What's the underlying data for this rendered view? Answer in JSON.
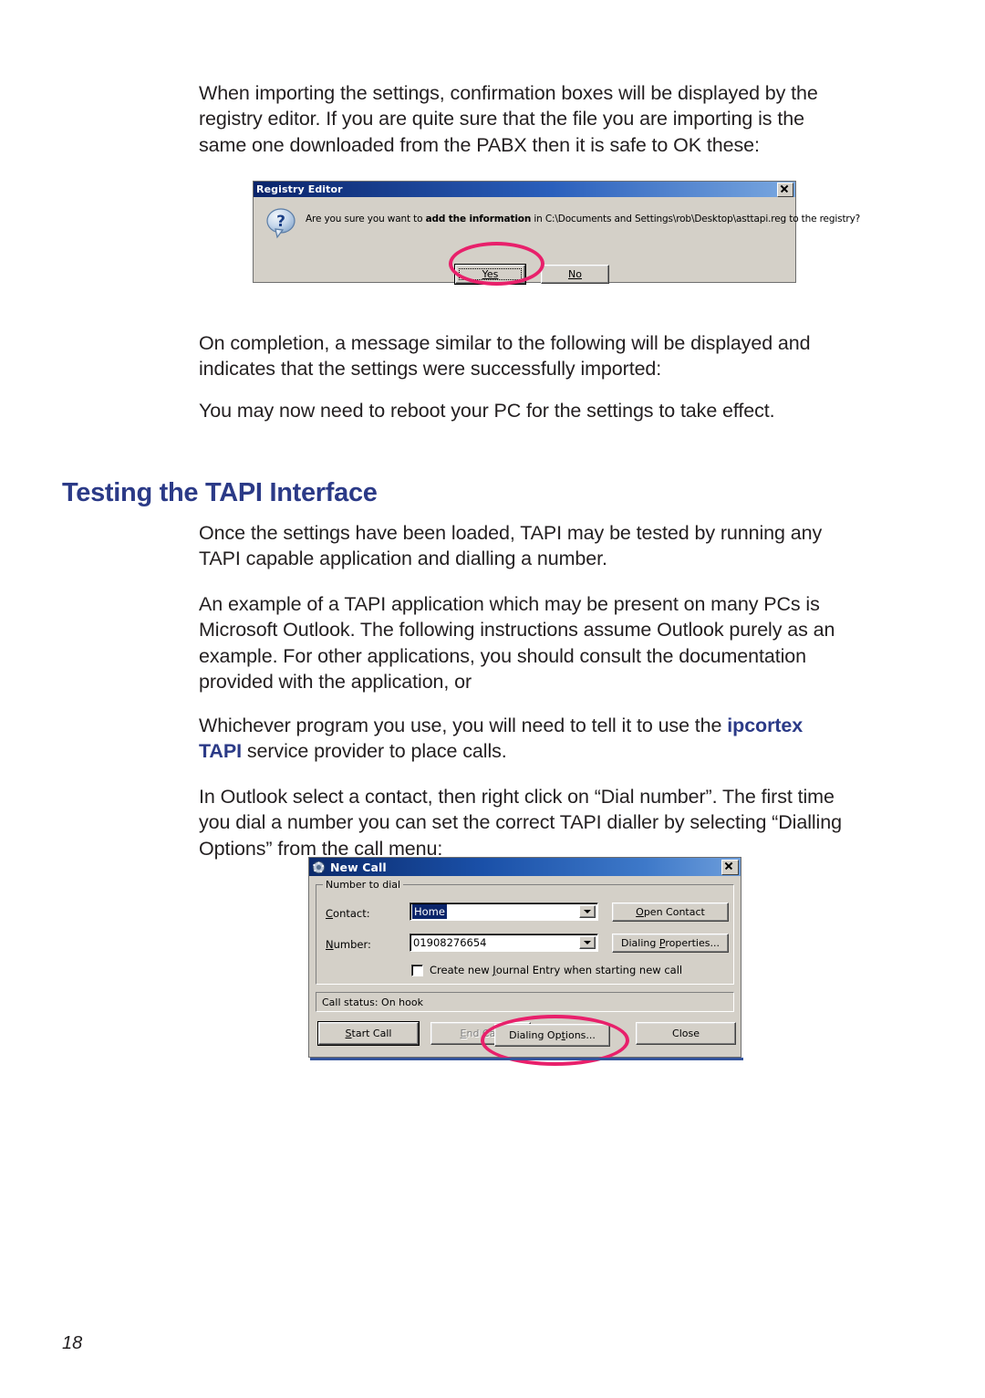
{
  "page": {
    "number": "18"
  },
  "paragraphs": {
    "p1": "When importing the settings, confirmation boxes will be displayed by the registry editor. If you are quite sure that the file you are importing is the same one downloaded from the PABX then it is safe to OK these:",
    "p2": "On completion, a message similar to the following will be displayed and indicates that the settings were successfully imported:",
    "p3": "You may now need to reboot your PC for the settings to take effect.",
    "p4": "Once the settings have been loaded, TAPI may be tested by running any TAPI capable application and dialling a number.",
    "p5": "An example of a TAPI application which may be present on many PCs is Microsoft Outlook. The following instructions assume Outlook purely as an example. For other applications, you should consult the documentation provided with the application, or",
    "p6_before": "Whichever program you use, you will need to tell it to use the ",
    "p6_brand": "ipcortex TAPI",
    "p6_after": " service provider to place calls.",
    "p7": "In Outlook select a contact, then right click on “Dial number”. The first time you dial a number you can set the correct TAPI dialler by selecting “Dialling Options” from the call menu:"
  },
  "heading": {
    "testing_tapi": "Testing the TAPI Interface",
    "color": "#2b3a87"
  },
  "registry_dialog": {
    "title": "Registry Editor",
    "icon": "question-bubble-icon",
    "message_a": "Are you sure you want to ",
    "message_b": "add the information",
    "message_c": " in C:\\Documents and Settings\\rob\\Desktop\\asttapi.reg to the registry?",
    "buttons": {
      "yes": "Yes",
      "yes_accelerator": "Y",
      "no": "No",
      "no_accelerator": "N"
    },
    "close_label": "✕"
  },
  "newcall_dialog": {
    "title": "New Call",
    "icon": "phone-dial-icon",
    "close_label": "✕",
    "group_label": "Number to dial",
    "contact_label": "Contact:",
    "contact_value": "Home",
    "number_label": "Number:",
    "number_value": "01908276654",
    "open_contact_label": "Open Contact",
    "dialing_properties_label": "Dialing Properties...",
    "journal_checkbox_label": "Create new Journal Entry when starting new call",
    "journal_checked": false,
    "call_status": "Call status:  On hook",
    "buttons": {
      "start_call": "Start Call",
      "end_call": "End Call",
      "end_call_disabled": true,
      "dialing_options": "Dialing Options...",
      "close": "Close"
    }
  },
  "annotations": {
    "color": "#e8206b",
    "ellipse_yes": "highlight-yes-button",
    "ellipse_dialing_options": "highlight-dialing-options-button"
  }
}
